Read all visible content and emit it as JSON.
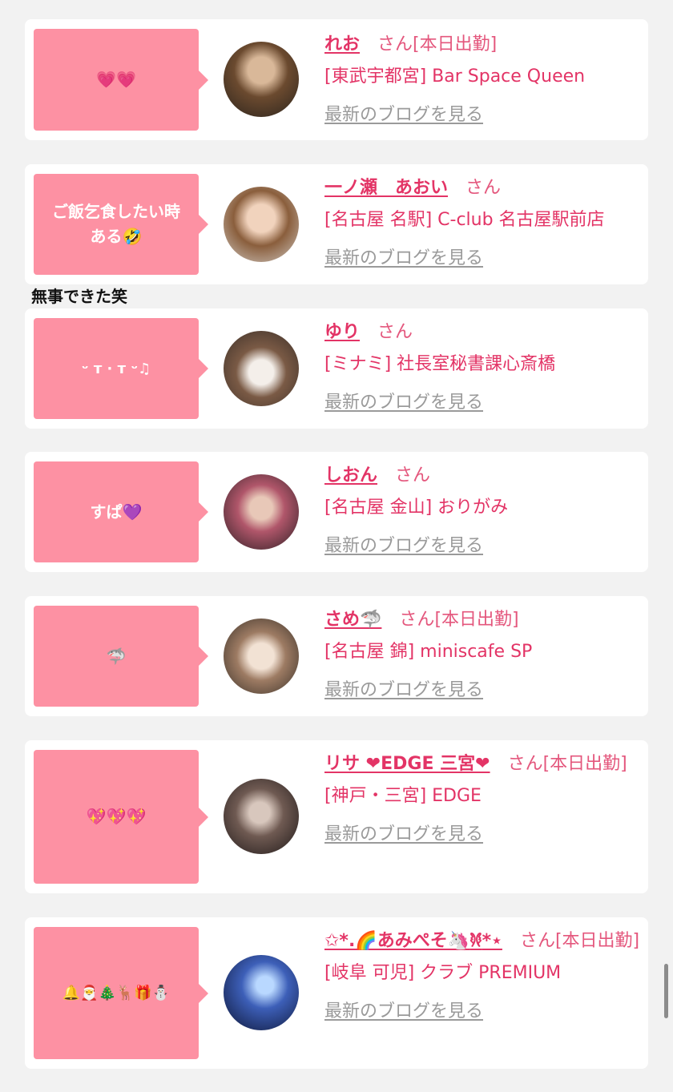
{
  "overlay_text": "無事できた笑",
  "honorific": "さん",
  "blog_link": "最新のブログを見る",
  "cards": [
    {
      "message": "💗💗",
      "name": "れお",
      "status": "[本日出勤]",
      "shop": "[東武宇都宮] Bar Space Queen"
    },
    {
      "message": "ご飯乞食したい時\nある🤣",
      "name": "一ノ瀬　あおい",
      "status": "",
      "shop": "[名古屋 名駅] C-club 名古屋駅前店"
    },
    {
      "message": "ᵕ ᴛ · ᴛ ᵕ♫",
      "name": "ゆり",
      "status": "",
      "shop": "[ミナミ] 社長室秘書課心斎橋"
    },
    {
      "message": "すぱ💜",
      "name": "しおん",
      "status": "",
      "shop": "[名古屋 金山] おりがみ"
    },
    {
      "message": "🦈",
      "name": "さめ🦈",
      "status": "[本日出勤]",
      "shop": "[名古屋 錦] miniscafe SP"
    },
    {
      "message": "💖💖💖",
      "name": "リサ ❤EDGE 三宮❤",
      "status": "[本日出勤]",
      "shop": "[神戸・三宮] EDGE"
    },
    {
      "message": "🔔🎅🎄🦌🎁⛄",
      "name": "✩*.🌈あみぺそ🦄𐦍*⋆",
      "status": "[本日出勤]",
      "shop": "[岐阜 可児] クラブ PREMIUM"
    }
  ],
  "colors": {
    "background": "#f2f2f2",
    "card": "#ffffff",
    "bubble": "#fd91a3",
    "accent": "#e33466",
    "muted_link": "#9a9a9a"
  }
}
